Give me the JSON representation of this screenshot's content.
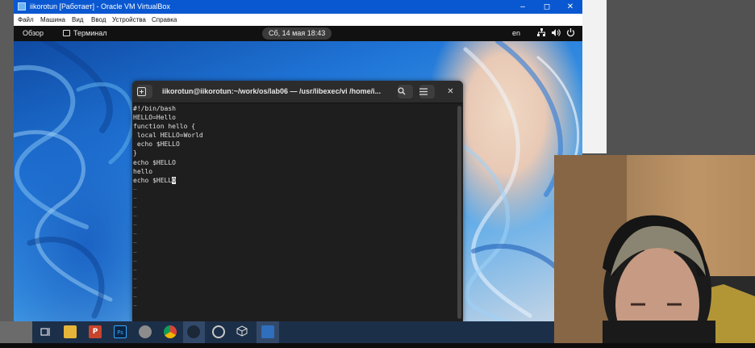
{
  "vbox": {
    "title": "iikorotun [Работает] - Oracle VM VirtualBox",
    "menu": [
      "Файл",
      "Машина",
      "Вид",
      "Ввод",
      "Устройства",
      "Справка"
    ],
    "controls": [
      "–",
      "◻",
      "✕"
    ]
  },
  "gnome": {
    "activities": "Обзор",
    "app_name": "Терминал",
    "clock": "Сб, 14 мая  18:43",
    "lang": "en",
    "status_icons": [
      "network-icon",
      "volume-icon",
      "power-icon"
    ]
  },
  "terminal": {
    "title": "iikorotun@iikorotun:~/work/os/lab06 — /usr/libexec/vi /home/i...",
    "lines": [
      "#!/bin/bash",
      "HELLO=Hello",
      "function hello {",
      " local HELLO=World",
      " echo $HELLO",
      "}",
      "echo $HELLO",
      "hello"
    ],
    "last_line_text": "echo $HELL",
    "cursor_char": "O",
    "tilde": "~"
  },
  "taskbar": {
    "icons": [
      "task-view-icon",
      "file-explorer-icon",
      "powerpoint-icon",
      "photoshop-icon",
      "app-icon",
      "chrome-icon",
      "steam-icon",
      "app-circle-icon",
      "virtualbox-3d-icon",
      "virtualbox-vm-icon"
    ]
  },
  "colors": {
    "vbox_title": "#0a58d1",
    "terminal_bg": "#1e1e1e",
    "taskbar": "#1c2f49"
  }
}
